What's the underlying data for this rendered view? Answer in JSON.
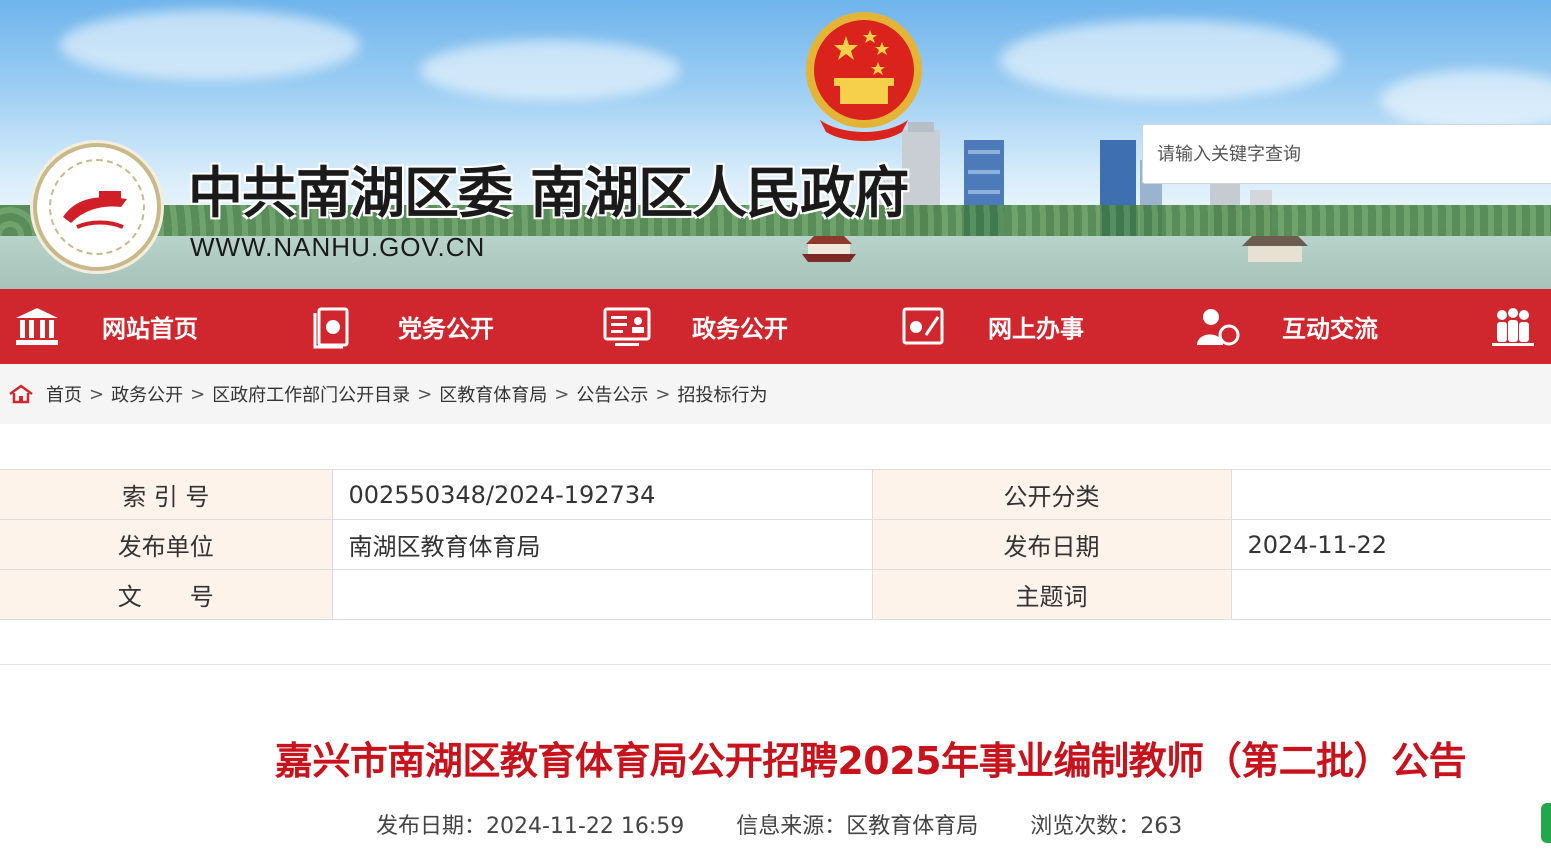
{
  "header": {
    "site_title": "中共南湖区委 南湖区人民政府",
    "domain": "WWW.NANHU.GOV.CN",
    "search_placeholder": "请输入关键字查询"
  },
  "nav": {
    "items": [
      {
        "label": "网站首页",
        "icon": "government-building-icon"
      },
      {
        "label": "党务公开",
        "icon": "party-document-icon"
      },
      {
        "label": "政务公开",
        "icon": "monitor-document-icon"
      },
      {
        "label": "网上办事",
        "icon": "online-service-icon"
      },
      {
        "label": "互动交流",
        "icon": "user-chat-icon"
      },
      {
        "label": "",
        "icon": "people-group-icon"
      }
    ]
  },
  "breadcrumb": [
    "首页",
    "政务公开",
    "区政府工作部门公开目录",
    "区教育体育局",
    "公告公示",
    "招投标行为"
  ],
  "meta": {
    "index_label": "索 引 号",
    "index_value": "002550348/2024-192734",
    "category_label": "公开分类",
    "category_value": "",
    "publisher_label": "发布单位",
    "publisher_value": "南湖区教育体育局",
    "date_label": "发布日期",
    "date_value": "2024-11-22",
    "docno_label": "文　　号",
    "docno_value": "",
    "subject_label": "主题词",
    "subject_value": ""
  },
  "article": {
    "title": "嘉兴市南湖区教育体育局公开招聘2025年事业编制教师（第二批）公告",
    "publish_date": "发布日期：2024-11-22 16:59",
    "source": "信息来源：区教育体育局",
    "views": "浏览次数：263"
  },
  "colors": {
    "nav_red": "#d0262d",
    "title_red": "#c8121c",
    "label_bg": "#fdf3ea"
  }
}
